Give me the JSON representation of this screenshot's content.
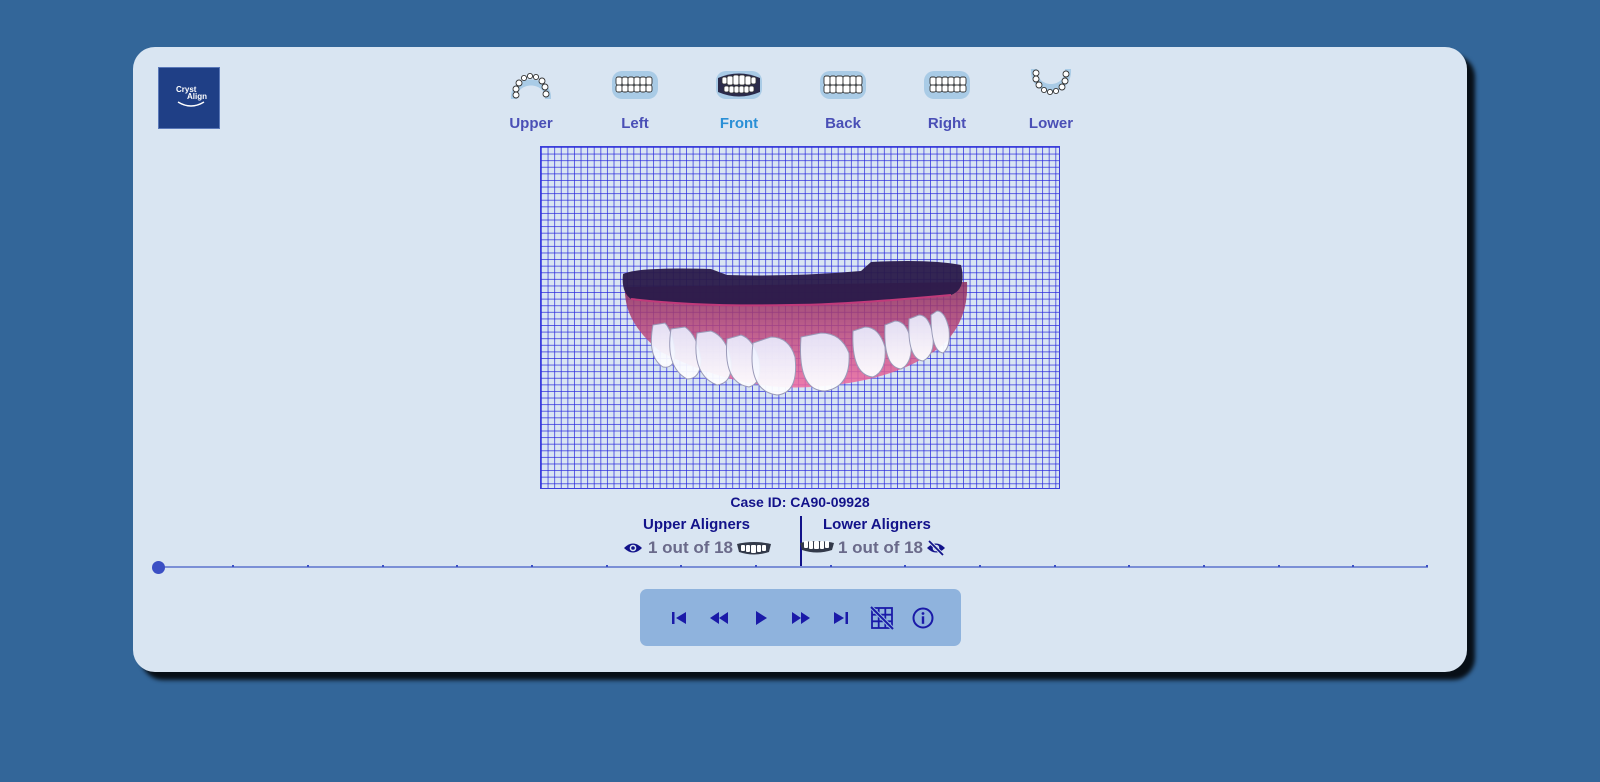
{
  "brand": {
    "line1": "Cryst",
    "line2": "Align"
  },
  "views": [
    {
      "id": "upper",
      "label": "Upper",
      "active": false
    },
    {
      "id": "left",
      "label": "Left",
      "active": false
    },
    {
      "id": "front",
      "label": "Front",
      "active": true
    },
    {
      "id": "back",
      "label": "Back",
      "active": false
    },
    {
      "id": "right",
      "label": "Right",
      "active": false
    },
    {
      "id": "lower",
      "label": "Lower",
      "active": false
    }
  ],
  "case": {
    "text": "Case ID: CA90-09928"
  },
  "upper": {
    "title": "Upper Aligners",
    "count": "1 out of 18",
    "visibility_icon": "eye-icon",
    "arch_icon": "upper-teeth-icon"
  },
  "lower": {
    "title": "Lower Aligners",
    "count": "1 out of 18",
    "visibility_icon": "eye-off-icon",
    "arch_icon": "lower-teeth-icon"
  },
  "timeline": {
    "current_step": 1,
    "total_steps": 18
  },
  "controls": [
    {
      "name": "first-step-icon"
    },
    {
      "name": "rewind-icon"
    },
    {
      "name": "play-icon"
    },
    {
      "name": "fast-forward-icon"
    },
    {
      "name": "last-step-icon"
    },
    {
      "name": "grid-toggle-icon"
    },
    {
      "name": "info-icon"
    }
  ],
  "colors": {
    "background": "#336699",
    "card": "#d9e5f2",
    "accent": "#12128a",
    "active_view": "#2a8fd6",
    "view_label": "#4a4fb6",
    "control_bar": "#8fb3dd"
  }
}
